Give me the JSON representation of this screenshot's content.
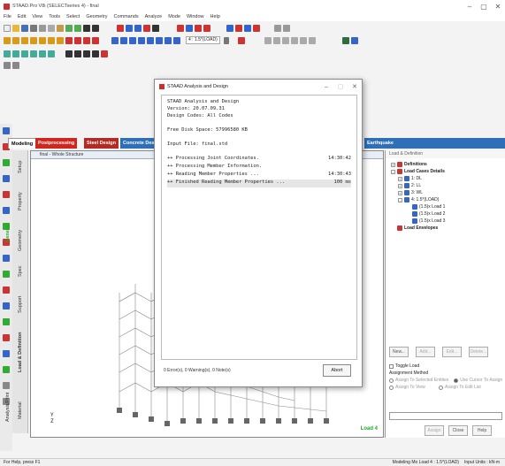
{
  "window": {
    "title": "STAAD.Pro V8i (SELECTseries 4) - final"
  },
  "menubar": [
    "File",
    "Edit",
    "View",
    "Tools",
    "Select",
    "Geometry",
    "Commands",
    "Analyze",
    "Mode",
    "Window",
    "Help"
  ],
  "toolbar": {
    "load_combo": "4 : 1.5*(LOAD)"
  },
  "page_tabs": {
    "modeling": "Modeling",
    "postprocessing": "Postprocessing",
    "steel_design": "Steel Design",
    "concrete_design": "Concrete Design",
    "earthquake": "Earthquake"
  },
  "vertical_tabs": {
    "general": "General",
    "setup": "Setup",
    "property": "Property",
    "geometry": "Geometry",
    "spec": "Spec",
    "support": "Support",
    "load": "Load & Definition",
    "analysis": "Analysis/Print",
    "design": "Design",
    "material": "Material"
  },
  "main_view": {
    "title": "final - Whole Structure",
    "load_label": "Load 4",
    "axis_y": "Y",
    "axis_z": "Z",
    "axis_x": "X"
  },
  "right_panel": {
    "title": "Load & Definition",
    "tree": {
      "definitions": "Definitions",
      "load_cases_details": "Load Cases Details",
      "lc1": "1: DL",
      "lc2": "2: LL",
      "lc3": "3: WL",
      "lc4": "4: 1.5*(LOAD)",
      "sub1": "(1.5)x Load 1",
      "sub2": "(1.5)x Load 2",
      "sub3": "(1.5)x Load 3",
      "load_envelopes": "Load Envelopes"
    },
    "buttons": {
      "new": "New...",
      "add": "Add...",
      "edit": "Edit...",
      "delete": "Delete..."
    },
    "toggle_load": "Toggle Load",
    "assignment_method": "Assignment Method",
    "assign_selected": "Assign To Selected Entities",
    "use_cursor": "Use Cursor To Assign",
    "assign_view": "Assign To View",
    "assign_edit_list": "Assign To Edit List",
    "assign_btn": "Assign",
    "close_btn": "Close",
    "help_btn": "Help"
  },
  "status": {
    "left": "For Help, press F1",
    "mode": "Modeling Mo Load 4 : 1.5*(LOAD)",
    "units": "Input Units : kN-m"
  },
  "dialog": {
    "title": "STAAD Analysis and Design",
    "lines": [
      "STAAD Analysis and Design",
      "Version: 20.07.09.31",
      "Design Codes: All Codes",
      "",
      "Free Disk Space: 57996580 KB",
      "",
      "Input File: final.std",
      ""
    ],
    "steps": [
      {
        "text": "++ Processing Joint Coordinates.",
        "time": "14:30:42"
      },
      {
        "text": "++ Processing Member Information.",
        "time": ""
      },
      {
        "text": "++ Reading Member Properties ...",
        "time": "14:30:43"
      },
      {
        "text": "++ Finished Reading Member Properties ...",
        "time": "100 ms"
      }
    ],
    "footer": "0 Error(s), 0 Warning(s), 0 Note(s)",
    "abort": "Abort"
  }
}
